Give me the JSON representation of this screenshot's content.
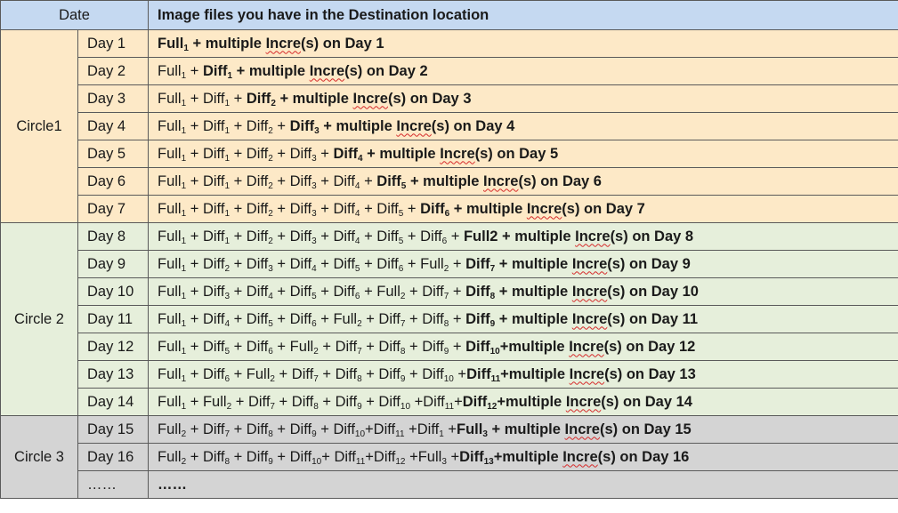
{
  "header": {
    "date_label": "Date",
    "files_label": "Image files you have in the Destination location"
  },
  "circles": [
    {
      "label": "Circle1",
      "tone": "c1",
      "rows": [
        {
          "day": "Day 1",
          "parts": [
            {
              "t": "Full",
              "s": "1",
              "b": true
            },
            {
              "t": " + multiple ",
              "b": true
            },
            {
              "t": "Incre",
              "b": true,
              "w": true
            },
            {
              "t": "(s) on Day 1",
              "b": true
            }
          ]
        },
        {
          "day": "Day 2",
          "parts": [
            {
              "t": "Full",
              "s": "1"
            },
            {
              "t": " + "
            },
            {
              "t": "Diff",
              "s": "1",
              "b": true
            },
            {
              "t": " + multiple ",
              "b": true
            },
            {
              "t": "Incre",
              "b": true,
              "w": true
            },
            {
              "t": "(s) on Day 2",
              "b": true
            }
          ]
        },
        {
          "day": "Day 3",
          "parts": [
            {
              "t": "Full",
              "s": "1"
            },
            {
              "t": " + Diff",
              "s": "1"
            },
            {
              "t": " + "
            },
            {
              "t": "Diff",
              "s": "2",
              "b": true
            },
            {
              "t": " + multiple ",
              "b": true
            },
            {
              "t": "Incre",
              "b": true,
              "w": true
            },
            {
              "t": "(s) on Day 3",
              "b": true
            }
          ]
        },
        {
          "day": "Day 4",
          "parts": [
            {
              "t": "Full",
              "s": "1"
            },
            {
              "t": " + Diff",
              "s": "1"
            },
            {
              "t": " + Diff",
              "s": "2"
            },
            {
              "t": " + "
            },
            {
              "t": "Diff",
              "s": "3",
              "b": true
            },
            {
              "t": " + multiple ",
              "b": true
            },
            {
              "t": "Incre",
              "b": true,
              "w": true
            },
            {
              "t": "(s) on Day 4",
              "b": true
            }
          ]
        },
        {
          "day": "Day 5",
          "parts": [
            {
              "t": "Full",
              "s": "1"
            },
            {
              "t": " + Diff",
              "s": "1"
            },
            {
              "t": " + Diff",
              "s": "2"
            },
            {
              "t": " + Diff",
              "s": "3"
            },
            {
              "t": " + "
            },
            {
              "t": "Diff",
              "s": "4",
              "b": true
            },
            {
              "t": " + multiple ",
              "b": true
            },
            {
              "t": "Incre",
              "b": true,
              "w": true
            },
            {
              "t": "(s) on Day 5",
              "b": true
            }
          ]
        },
        {
          "day": "Day 6",
          "parts": [
            {
              "t": "Full",
              "s": "1"
            },
            {
              "t": " + Diff",
              "s": "1"
            },
            {
              "t": " + Diff",
              "s": "2"
            },
            {
              "t": " + Diff",
              "s": "3"
            },
            {
              "t": " + Diff",
              "s": "4"
            },
            {
              "t": " + "
            },
            {
              "t": "Diff",
              "s": "5",
              "b": true
            },
            {
              "t": " + multiple ",
              "b": true
            },
            {
              "t": "Incre",
              "b": true,
              "w": true
            },
            {
              "t": "(s) on Day 6",
              "b": true
            }
          ]
        },
        {
          "day": "Day 7",
          "parts": [
            {
              "t": "Full",
              "s": "1"
            },
            {
              "t": " + Diff",
              "s": "1"
            },
            {
              "t": " + Diff",
              "s": "2"
            },
            {
              "t": " + Diff",
              "s": "3"
            },
            {
              "t": " + Diff",
              "s": "4"
            },
            {
              "t": " + Diff",
              "s": "5"
            },
            {
              "t": " + "
            },
            {
              "t": "Diff",
              "s": "6",
              "b": true
            },
            {
              "t": " + multiple ",
              "b": true
            },
            {
              "t": "Incre",
              "b": true,
              "w": true
            },
            {
              "t": "(s) on Day 7",
              "b": true
            }
          ]
        }
      ]
    },
    {
      "label": "Circle 2",
      "tone": "c2",
      "rows": [
        {
          "day": "Day 8",
          "parts": [
            {
              "t": "Full",
              "s": "1"
            },
            {
              "t": " + Diff",
              "s": "1"
            },
            {
              "t": " + Diff",
              "s": "2"
            },
            {
              "t": " + Diff",
              "s": "3"
            },
            {
              "t": " + Diff",
              "s": "4"
            },
            {
              "t": " + Diff",
              "s": "5"
            },
            {
              "t": " + Diff",
              "s": "6"
            },
            {
              "t": " + "
            },
            {
              "t": "Full2",
              "b": true
            },
            {
              "t": " + multiple ",
              "b": true
            },
            {
              "t": "Incre",
              "b": true,
              "w": true
            },
            {
              "t": "(s) on Day 8",
              "b": true
            }
          ]
        },
        {
          "day": "Day 9",
          "parts": [
            {
              "t": "Full",
              "s": "1"
            },
            {
              "t": " + Diff",
              "s": "2"
            },
            {
              "t": " + Diff",
              "s": "3"
            },
            {
              "t": " + Diff",
              "s": "4"
            },
            {
              "t": " + Diff",
              "s": "5"
            },
            {
              "t": " + Diff",
              "s": "6"
            },
            {
              "t": " + Full",
              "s": "2"
            },
            {
              "t": " + "
            },
            {
              "t": "Diff",
              "s": "7",
              "b": true
            },
            {
              "t": " + multiple ",
              "b": true
            },
            {
              "t": "Incre",
              "b": true,
              "w": true
            },
            {
              "t": "(s) on Day 9",
              "b": true
            }
          ]
        },
        {
          "day": "Day 10",
          "parts": [
            {
              "t": "Full",
              "s": "1"
            },
            {
              "t": " + Diff",
              "s": "3"
            },
            {
              "t": " + Diff",
              "s": "4"
            },
            {
              "t": " + Diff",
              "s": "5"
            },
            {
              "t": " + Diff",
              "s": "6"
            },
            {
              "t": " + Full",
              "s": "2"
            },
            {
              "t": " + Diff",
              "s": "7"
            },
            {
              "t": " + "
            },
            {
              "t": "Diff",
              "s": "8",
              "b": true
            },
            {
              "t": " + multiple ",
              "b": true
            },
            {
              "t": "Incre",
              "b": true,
              "w": true
            },
            {
              "t": "(s) on Day 10",
              "b": true
            }
          ]
        },
        {
          "day": "Day 11",
          "parts": [
            {
              "t": "Full",
              "s": "1"
            },
            {
              "t": " + Diff",
              "s": "4"
            },
            {
              "t": " + Diff",
              "s": "5"
            },
            {
              "t": " + Diff",
              "s": "6"
            },
            {
              "t": " + Full",
              "s": "2"
            },
            {
              "t": " + Diff",
              "s": "7"
            },
            {
              "t": " + Diff",
              "s": "8"
            },
            {
              "t": " + "
            },
            {
              "t": "Diff",
              "s": "9",
              "b": true
            },
            {
              "t": " + multiple ",
              "b": true
            },
            {
              "t": "Incre",
              "b": true,
              "w": true
            },
            {
              "t": "(s) on Day 11",
              "b": true
            }
          ]
        },
        {
          "day": "Day 12",
          "parts": [
            {
              "t": "Full",
              "s": "1"
            },
            {
              "t": " + Diff",
              "s": "5"
            },
            {
              "t": " + Diff",
              "s": "6"
            },
            {
              "t": " + Full",
              "s": "2"
            },
            {
              "t": " + Diff",
              "s": "7"
            },
            {
              "t": " + Diff",
              "s": "8"
            },
            {
              "t": " + Diff",
              "s": "9"
            },
            {
              "t": " + "
            },
            {
              "t": "Diff",
              "s": "10",
              "b": true
            },
            {
              "t": "+multiple ",
              "b": true
            },
            {
              "t": "Incre",
              "b": true,
              "w": true
            },
            {
              "t": "(s) on Day 12",
              "b": true
            }
          ]
        },
        {
          "day": "Day 13",
          "parts": [
            {
              "t": "Full",
              "s": "1"
            },
            {
              "t": " + Diff",
              "s": "6"
            },
            {
              "t": " + Full",
              "s": "2"
            },
            {
              "t": " + Diff",
              "s": "7"
            },
            {
              "t": " + Diff",
              "s": "8"
            },
            {
              "t": " + Diff",
              "s": "9"
            },
            {
              "t": " + Diff",
              "s": "10"
            },
            {
              "t": " +"
            },
            {
              "t": "Diff",
              "s": "11",
              "b": true
            },
            {
              "t": "+multiple ",
              "b": true
            },
            {
              "t": "Incre",
              "b": true,
              "w": true
            },
            {
              "t": "(s) on Day 13",
              "b": true
            }
          ]
        },
        {
          "day": "Day 14",
          "parts": [
            {
              "t": "Full",
              "s": "1"
            },
            {
              "t": " + Full",
              "s": "2"
            },
            {
              "t": " + Diff",
              "s": "7"
            },
            {
              "t": " + Diff",
              "s": "8"
            },
            {
              "t": " + Diff",
              "s": "9"
            },
            {
              "t": " + Diff",
              "s": "10"
            },
            {
              "t": " +Diff",
              "s": "11"
            },
            {
              "t": "+"
            },
            {
              "t": "Diff",
              "s": "12",
              "b": true
            },
            {
              "t": "+multiple ",
              "b": true
            },
            {
              "t": "Incre",
              "b": true,
              "w": true
            },
            {
              "t": "(s) on Day 14",
              "b": true
            }
          ]
        }
      ]
    },
    {
      "label": "Circle 3",
      "tone": "c3",
      "rows": [
        {
          "day": "Day 15",
          "parts": [
            {
              "t": "Full",
              "s": "2"
            },
            {
              "t": " + Diff",
              "s": "7"
            },
            {
              "t": " + Diff",
              "s": "8"
            },
            {
              "t": " + Diff",
              "s": "9"
            },
            {
              "t": " + Diff",
              "s": "10"
            },
            {
              "t": "+Diff",
              "s": "11"
            },
            {
              "t": " +Diff",
              "s": "1"
            },
            {
              "t": " +"
            },
            {
              "t": "Full",
              "s": "3",
              "b": true
            },
            {
              "t": " + multiple ",
              "b": true
            },
            {
              "t": "Incre",
              "b": true,
              "w": true
            },
            {
              "t": "(s) on Day 15",
              "b": true
            }
          ]
        },
        {
          "day": "Day 16",
          "parts": [
            {
              "t": "Full",
              "s": "2"
            },
            {
              "t": " + Diff",
              "s": "8"
            },
            {
              "t": " + Diff",
              "s": "9"
            },
            {
              "t": " + Diff",
              "s": "10"
            },
            {
              "t": "+ Diff",
              "s": "11"
            },
            {
              "t": "+Diff",
              "s": "12"
            },
            {
              "t": " +Full",
              "s": "3"
            },
            {
              "t": " +"
            },
            {
              "t": "Diff",
              "s": "13",
              "b": true
            },
            {
              "t": "+multiple ",
              "b": true
            },
            {
              "t": "Incre",
              "b": true,
              "w": true
            },
            {
              "t": "(s) on Day 16",
              "b": true
            }
          ]
        },
        {
          "day": "……",
          "parts": [
            {
              "t": "……",
              "b": true
            }
          ]
        }
      ]
    }
  ]
}
